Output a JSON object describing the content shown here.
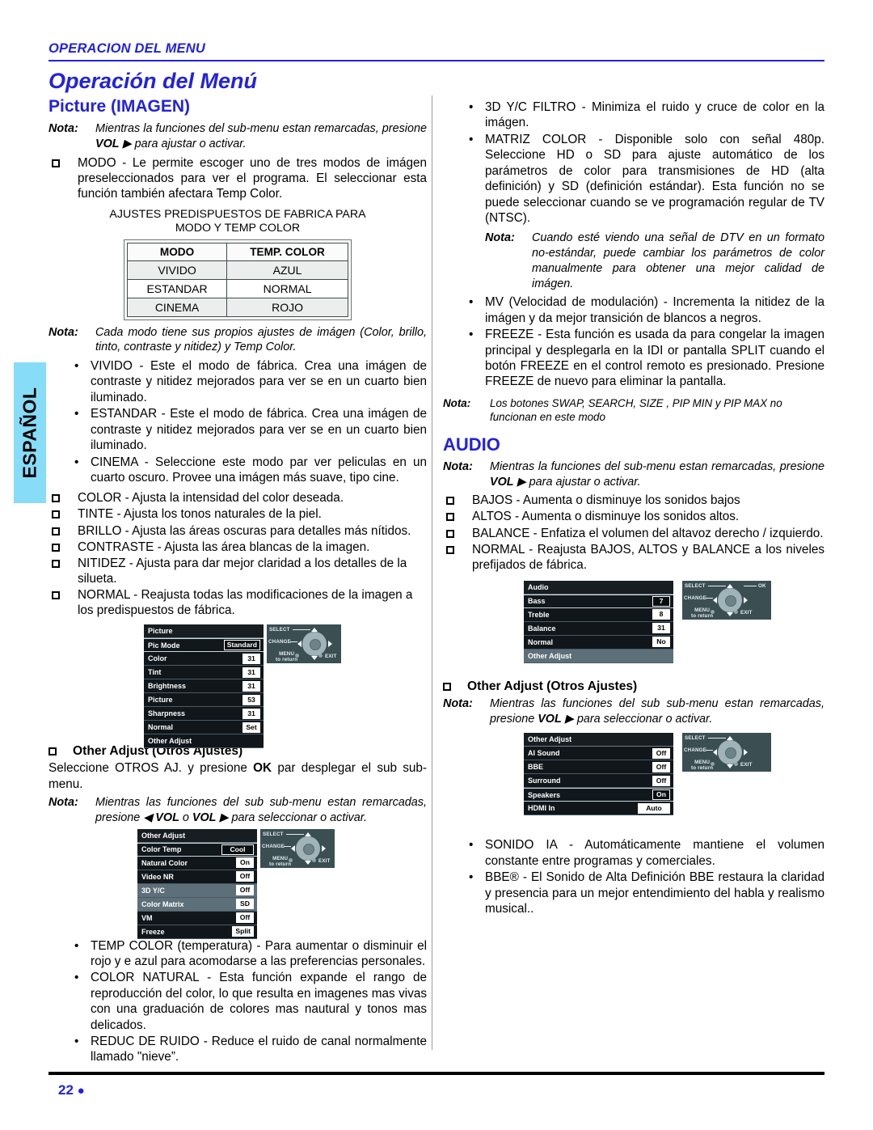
{
  "header": {
    "running_head": "OPERACION DEL MENU",
    "page_title": "Operación del Menú"
  },
  "footer": {
    "page_number": "22",
    "bullet": "●"
  },
  "side_tab": {
    "label": "ESPAÑOL"
  },
  "left_column": {
    "section_title": "Picture (IMAGEN)",
    "note_1": {
      "label": "Nota:",
      "text_a": "Mientras la funciones del sub-menu estan remarcadas, presione ",
      "bold": "VOL",
      "arrow": "▶",
      "text_b": " para ajustar o activar."
    },
    "modo_item": "MODO - Le permite escoger uno de tres modos de imágen preseleccionados para ver el programa. El seleccionar esta función también afectara Temp Color.",
    "table": {
      "caption_line1": "AJUSTES PREDISPUESTOS DE FABRICA PARA",
      "caption_line2": "MODO Y TEMP COLOR",
      "headers": [
        "MODO",
        "TEMP. COLOR"
      ],
      "rows": [
        [
          "VIVIDO",
          "AZUL"
        ],
        [
          "ESTANDAR",
          "NORMAL"
        ],
        [
          "CINEMA",
          "ROJO"
        ]
      ]
    },
    "note_2": {
      "label": "Nota:",
      "text": "Cada modo tiene sus propios ajustes de imágen (Color, brillo, tinto, contraste y nitidez) y Temp Color."
    },
    "mode_bullets": [
      "VIVIDO - Este el modo de fábrica. Crea una imágen de contraste y nitidez mejorados para ver se en un cuarto bien iluminado.",
      "ESTANDAR - Este el modo de fábrica. Crea una imágen de contraste y nitidez mejorados para ver se en un cuarto bien iluminado.",
      "CINEMA - Seleccione este modo par ver peliculas en un cuarto oscuro. Provee una imágen más suave, tipo cine."
    ],
    "square_items": [
      "COLOR - Ajusta la intensidad del color deseada.",
      "TINTE -  Ajusta los tonos naturales de la piel.",
      "BRILLO - Ajusta las áreas oscuras para detalles más nítidos.",
      "CONTRASTE - Ajusta las área blancas de la imagen.",
      "NITIDEZ - Ajusta para dar mejor claridad a los detalles de la silueta.",
      "NORMAL - Reajusta todas las modificaciones de la imagen a los predispuestos de fábrica."
    ],
    "osd_picture": {
      "title": "Picture",
      "rows": [
        {
          "label": "Pic Mode",
          "value": "Standard",
          "state": "sel",
          "value_style": "inv"
        },
        {
          "label": "Color",
          "value": "31",
          "state": "norm",
          "value_style": "plain"
        },
        {
          "label": "Tint",
          "value": "31",
          "state": "norm",
          "value_style": "plain"
        },
        {
          "label": "Brightness",
          "value": "31",
          "state": "norm",
          "value_style": "plain"
        },
        {
          "label": "Picture",
          "value": "53",
          "state": "norm",
          "value_style": "plain"
        },
        {
          "label": "Sharpness",
          "value": "31",
          "state": "norm",
          "value_style": "plain"
        },
        {
          "label": "Normal",
          "value": "Set",
          "state": "norm",
          "value_style": "plain"
        },
        {
          "label": "Other Adjust",
          "value": "",
          "state": "norm",
          "value_style": "none"
        }
      ]
    },
    "other_adjust_head": "Other Adjust (Otros Ajustes)",
    "other_adjust_para_a": "Seleccione OTROS AJ. y presione ",
    "other_adjust_para_ok": "OK",
    "other_adjust_para_b": " par desplegar el sub sub-menu.",
    "note_3": {
      "label": "Nota:",
      "text_a": "Mientras las funciones del sub sub-menu estan remarcadas, presione ",
      "arrow_left": "◀",
      "vol1": "VOL",
      "o": " o ",
      "vol2": "VOL",
      "arrow_right": "▶",
      "text_b": " para seleccionar o activar."
    },
    "osd_other_adjust": {
      "title": "Other Adjust",
      "rows": [
        {
          "label": "Color Temp",
          "value": "Cool",
          "state": "sel",
          "value_style": "inv"
        },
        {
          "label": "Natural Color",
          "value": "On",
          "state": "norm",
          "value_style": "plain"
        },
        {
          "label": "Video NR",
          "value": "Off",
          "state": "norm",
          "value_style": "plain"
        },
        {
          "label": "3D Y/C",
          "value": "Off",
          "state": "gry",
          "value_style": "plain"
        },
        {
          "label": "Color Matrix",
          "value": "SD",
          "state": "gry",
          "value_style": "plain"
        },
        {
          "label": "VM",
          "value": "Off",
          "state": "norm",
          "value_style": "plain"
        },
        {
          "label": "Freeze",
          "value": "Split",
          "state": "norm",
          "value_style": "plain"
        }
      ]
    },
    "bottom_bullets": [
      "TEMP COLOR (temperatura) - Para aumentar o disminuir el rojo y e azul para acomodarse a las preferencias personales.",
      "COLOR NATURAL - Esta función expande el rango de reproducción del color, lo que resulta en imagenes mas vivas con una graduación de colores mas nautural y tonos mas delicados.",
      "REDUC DE RUIDO - Reduce el ruido de canal normalmente llamado \"nieve”."
    ]
  },
  "right_column": {
    "top_bullets": [
      "3D Y/C FILTRO - Minimiza el ruido y cruce de color en la imágen.",
      "MATRIZ COLOR - Disponible solo con señal 480p. Seleccione HD o SD para ajuste automático de los parámetros de color para transmisiones de HD (alta definición) y SD (definición estándar). Esta función no se puede seleccionar cuando se ve programación regular de TV (NTSC)."
    ],
    "note_dtv": {
      "label": "Nota:",
      "text": "Cuando esté viendo una señal de DTV en un formato no-estándar, puede cambiar los parámetros de color manualmente para obtener una mejor calidad de imágen."
    },
    "bullets_2": [
      "MV (Velocidad de modulación) - Incrementa la nitidez de la imágen y da mejor transición de blancos a negros.",
      "FREEZE - Esta función es usada da para congelar la imagen principal y desplegarla en la IDI or pantalla SPLIT cuando el botón FREEZE en el control remoto es presionado. Presione FREEZE de nuevo para eliminar la pantalla."
    ],
    "note_buttons": {
      "label": "Nota:",
      "text": "Los botones SWAP, SEARCH, SIZE , PIP MIN y PIP MAX no funcionan en este modo"
    },
    "audio_title": "AUDIO",
    "note_audio": {
      "label": "Nota:",
      "text_a": "Mientras la funciones del sub-menu estan remarcadas, presione ",
      "bold": "VOL",
      "arrow": "▶",
      "text_b": " para ajustar o activar."
    },
    "audio_square_items": [
      "BAJOS - Aumenta o disminuye los sonidos bajos",
      "ALTOS  - Aumenta o disminuye los sonidos altos.",
      "BALANCE - Enfatiza el volumen del altavoz derecho / izquierdo.",
      "NORMAL - Reajusta BAJOS, ALTOS y BALANCE a los niveles prefijados de fábrica."
    ],
    "osd_audio": {
      "title": "Audio",
      "rows": [
        {
          "label": "Bass",
          "value": "7",
          "state": "sel",
          "value_style": "inv"
        },
        {
          "label": "Treble",
          "value": "8",
          "state": "norm",
          "value_style": "plain"
        },
        {
          "label": "Balance",
          "value": "31",
          "state": "norm",
          "value_style": "plain"
        },
        {
          "label": "Normal",
          "value": "No",
          "state": "norm",
          "value_style": "plain"
        },
        {
          "label": "Other Adjust",
          "value": "",
          "state": "gry",
          "value_style": "none"
        }
      ]
    },
    "other_adjust_head": "Other Adjust (Otros Ajustes)",
    "note_other": {
      "label": "Nota:",
      "text_a": "Mientras las funciones del sub sub-menu estan remarcadas, presione ",
      "bold": "VOL",
      "arrow": "▶",
      "text_b": " para seleccionar o activar."
    },
    "osd_audio_other": {
      "title": "Other Adjust",
      "rows": [
        {
          "label": "AI Sound",
          "value": "Off",
          "state": "norm",
          "value_style": "plain"
        },
        {
          "label": "BBE",
          "value": "Off",
          "state": "norm",
          "value_style": "plain"
        },
        {
          "label": "Surround",
          "value": "Off",
          "state": "norm",
          "value_style": "plain"
        },
        {
          "label": "Speakers",
          "value": "On",
          "state": "sel",
          "value_style": "inv"
        },
        {
          "label": "HDMI In",
          "value": "Auto",
          "state": "norm",
          "value_style": "plain"
        }
      ]
    },
    "bottom_bullets": [
      "SONIDO IA - Automáticamente mantiene el volumen constante entre programas y comerciales.",
      "BBE® - El Sonido de Alta Definición BBE restaura la claridad y presencia para un mejor entendimiento del habla y realismo musical.."
    ]
  },
  "pad_labels": {
    "select": "SELECT",
    "change": "CHANGE",
    "menu_line1": "MENU",
    "menu_line2": "to return",
    "exit": "EXIT",
    "ok": "OK"
  },
  "colors": {
    "brand_blue": "#2222dd",
    "tab_blue": "#87dcf7",
    "osd_dark": "#10161a",
    "osd_gray": "#5d6f79",
    "pad_bg": "#3b4f53"
  }
}
